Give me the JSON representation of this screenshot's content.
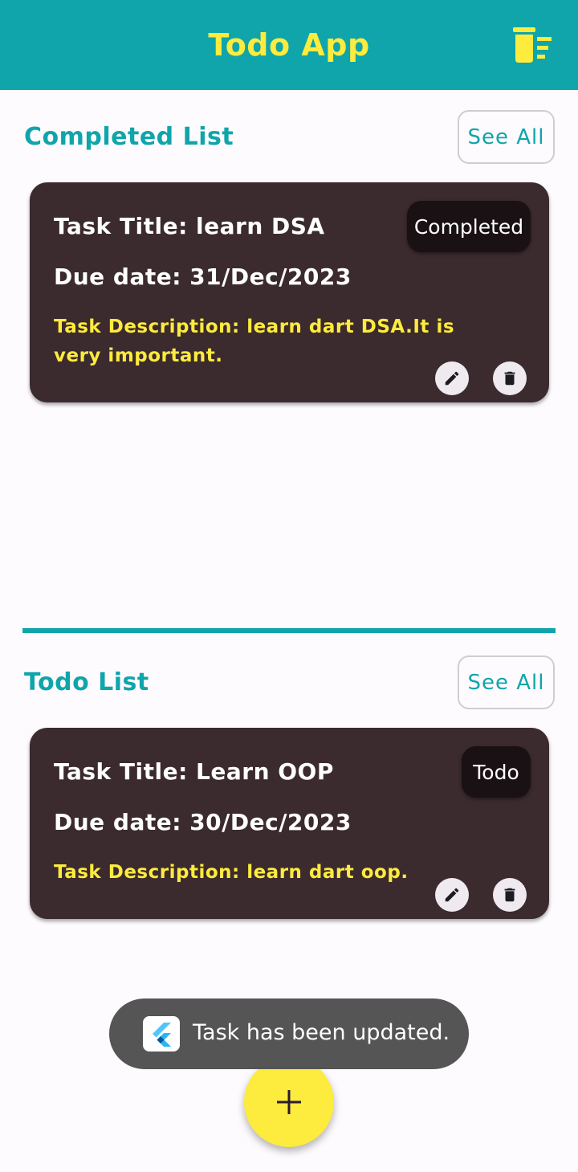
{
  "appbar": {
    "title": "Todo App",
    "action_icon": "delete-sweep-icon"
  },
  "completed_section": {
    "title": "Completed List",
    "see_all_label": "See All",
    "tasks": [
      {
        "title": "Task Title: learn DSA",
        "due_date": "Due date: 31/Dec/2023",
        "description": "Task Description: learn dart DSA.It is very important.",
        "status": "Completed"
      }
    ]
  },
  "todo_section": {
    "title": "Todo List",
    "see_all_label": "See All",
    "tasks": [
      {
        "title": "Task Title: Learn OOP",
        "due_date": "Due date: 30/Dec/2023",
        "description": "Task Description: learn dart oop.",
        "status": "Todo"
      }
    ]
  },
  "toast": {
    "message": "Task has been updated."
  },
  "fab": {
    "icon": "add-icon"
  },
  "colors": {
    "primary": "#0fa5aa",
    "accent": "#fdeb3d",
    "card": "#3b2a2e",
    "background": "#fefbff"
  }
}
